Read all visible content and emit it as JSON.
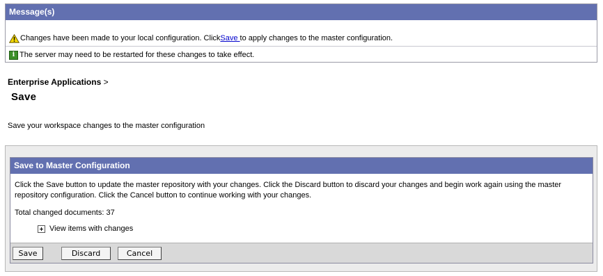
{
  "messages": {
    "header": "Message(s)",
    "warning_prefix": "Changes have been made to your local configuration. Click ",
    "warning_link": "Save ",
    "warning_suffix": "to apply changes to the master configuration.",
    "info_text": "The server may need to be restarted for these changes to take effect.",
    "warning_icon": "warning-triangle-icon",
    "info_icon": "info-icon"
  },
  "breadcrumb": {
    "item": "Enterprise Applications",
    "separator": ">"
  },
  "page": {
    "title": "Save",
    "description": "Save your workspace changes to the master configuration"
  },
  "panel": {
    "header": "Save to Master Configuration",
    "instructions": "Click the Save button to update the master repository with your changes. Click the Discard button to discard your changes and begin work again using the master repository configuration. Click the Cancel button to continue working with your changes.",
    "total_changed": "Total changed documents: 37",
    "view_items": "View items with changes"
  },
  "buttons": {
    "save": "Save",
    "discard": "Discard",
    "cancel": "Cancel"
  },
  "colors": {
    "header_bg": "#6270b0",
    "link": "#0000cc"
  }
}
